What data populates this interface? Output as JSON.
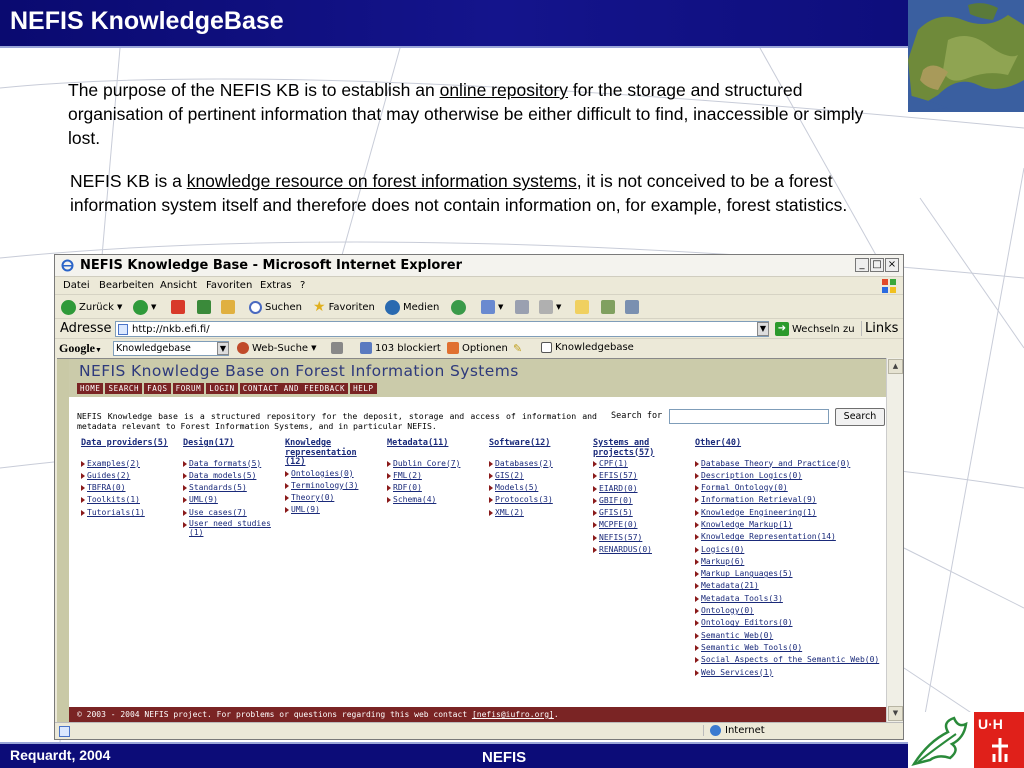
{
  "slide": {
    "title": "NEFIS KnowledgeBase",
    "para1": {
      "before": "The purpose of the NEFIS KB is to establish an ",
      "link": "online repository",
      "after": " for the storage and structured organisation of pertinent information that may otherwise be either difficult to find, inaccessible or simply lost."
    },
    "para2": {
      "before": "NEFIS KB is a ",
      "link": "knowledge resource on forest information systems",
      "after": ", it is not conceived to be a forest information system itself and therefore does not contain information on, for example, forest statistics."
    },
    "footer_author": "Requardt, 2004",
    "footer_center": "NEFIS",
    "logo_text": "U·H"
  },
  "browser": {
    "window_title": "NEFIS Knowledge Base - Microsoft Internet Explorer",
    "menu": [
      "Datei",
      "Bearbeiten",
      "Ansicht",
      "Favoriten",
      "Extras",
      "?"
    ],
    "toolbar": {
      "back": "Zurück",
      "search": "Suchen",
      "favorites": "Favoriten",
      "media": "Medien"
    },
    "address": {
      "label": "Adresse",
      "url": "http://nkb.efi.fi/",
      "go": "Wechseln zu",
      "links": "Links"
    },
    "google": {
      "logo": "Google",
      "query": "Knowledgebase",
      "web_search": "Web-Suche",
      "blocked": "103 blockiert",
      "options": "Optionen",
      "term": "Knowledgebase"
    },
    "status": {
      "zone": "Internet"
    }
  },
  "site": {
    "title": "NEFIS Knowledge Base on Forest Information Systems",
    "nav": [
      "HOME",
      "SEARCH",
      "FAQS",
      "FORUM",
      "LOGIN",
      "CONTACT AND FEEDBACK",
      "HELP"
    ],
    "intro": "NEFIS Knowledge base is a structured repository for the deposit, storage and access of information and metadata relevant to Forest Information Systems, and in particular NEFIS.",
    "search_label": "Search for :",
    "search_button": "Search",
    "categories": [
      {
        "heading": "Data providers(5)",
        "items": [
          "Examples(2)",
          "Guides(2)",
          "TBFRA(0)",
          "Toolkits(1)",
          "Tutorials(1)"
        ]
      },
      {
        "heading": "Design(17)",
        "items": [
          "Data formats(5)",
          "Data models(5)",
          "Standards(5)",
          "UML(9)",
          "Use cases(7)",
          "User need studies (1)"
        ]
      },
      {
        "heading": "Knowledge representation (12)",
        "items": [
          "Ontologies(0)",
          "Terminology(3)",
          "Theory(0)",
          "UML(9)"
        ]
      },
      {
        "heading": "Metadata(11)",
        "items": [
          "Dublin Core(7)",
          "FML(2)",
          "RDF(0)",
          "Schema(4)"
        ]
      },
      {
        "heading": "Software(12)",
        "items": [
          "Databases(2)",
          "GIS(2)",
          "Models(5)",
          "Protocols(3)",
          "XML(2)"
        ]
      },
      {
        "heading": "Systems and projects(57)",
        "items": [
          "CPF(1)",
          "EFIS(57)",
          "EIARD(0)",
          "GBIF(0)",
          "GFIS(5)",
          "MCPFE(0)",
          "NEFIS(57)",
          "RENARDUS(0)"
        ]
      },
      {
        "heading": "Other(40)",
        "items": [
          "Database Theory and Practice(0)",
          "Description Logics(0)",
          "Formal Ontology(0)",
          "Information Retrieval(9)",
          "Knowledge Engineering(1)",
          "Knowledge Markup(1)",
          "Knowledge Representation(14)",
          "Logics(0)",
          "Markup(6)",
          "Markup Languages(5)",
          "Metadata(21)",
          "Metadata Tools(3)",
          "Ontology(0)",
          "Ontology Editors(0)",
          "Semantic Web(0)",
          "Semantic Web Tools(0)",
          "Social Aspects of the Semantic Web(0)",
          "Web Services(1)"
        ]
      }
    ],
    "footer": {
      "text": "© 2003 - 2004 NEFIS project. For problems or questions regarding this web contact ",
      "email": "[nefis@iufro.org]",
      "end": "."
    }
  }
}
